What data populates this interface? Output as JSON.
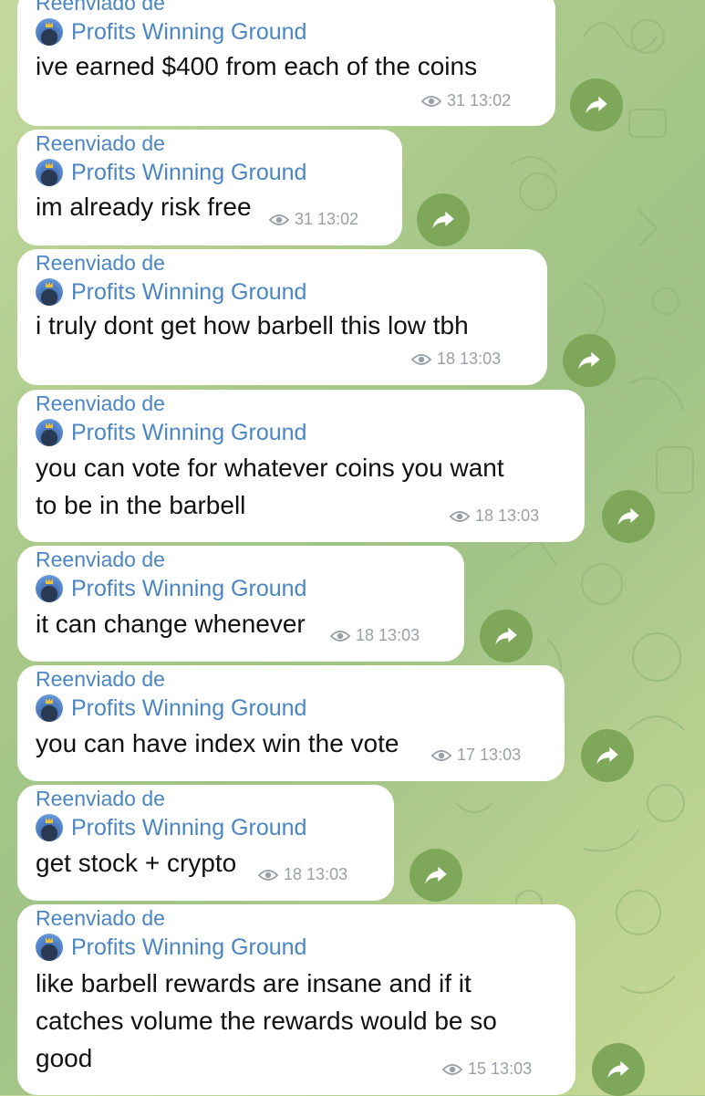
{
  "forward_label": "Reenviado de",
  "channel_name": "Profits Winning Ground",
  "colors": {
    "link_blue": "#4b86c4",
    "bubble_bg": "#ffffff",
    "share_button": "#7ea75a",
    "meta_gray": "#9aa0a6"
  },
  "messages": [
    {
      "text_lines": [
        "ive earned $400 from each of the coins"
      ],
      "views": "31",
      "time": "13:02"
    },
    {
      "text_lines": [
        "im already risk free"
      ],
      "views": "31",
      "time": "13:02"
    },
    {
      "text_lines": [
        "i truly dont get how barbell this low tbh"
      ],
      "views": "18",
      "time": "13:03"
    },
    {
      "text_lines": [
        "you can vote for whatever coins you want",
        "to be in the barbell"
      ],
      "views": "18",
      "time": "13:03"
    },
    {
      "text_lines": [
        "it can change whenever"
      ],
      "views": "18",
      "time": "13:03"
    },
    {
      "text_lines": [
        "you can have index win the vote"
      ],
      "views": "17",
      "time": "13:03"
    },
    {
      "text_lines": [
        "get stock + crypto"
      ],
      "views": "18",
      "time": "13:03"
    },
    {
      "text_lines": [
        "like barbell rewards are insane and if it",
        "catches volume the rewards would be so",
        "good"
      ],
      "views": "15",
      "time": "13:03"
    }
  ],
  "icons": {
    "views": "eye-icon",
    "share": "share-arrow-icon",
    "avatar": "channel-avatar"
  }
}
